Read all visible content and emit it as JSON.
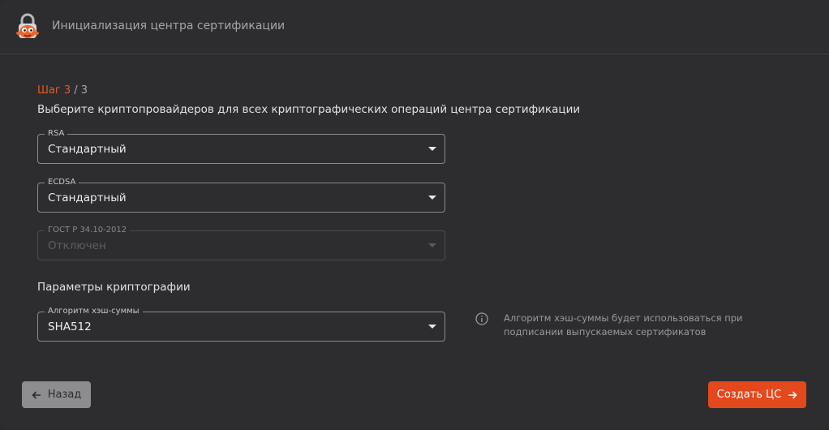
{
  "header": {
    "title": "Инициализация центра сертификации",
    "logo_icon": "padlock-mascot-icon"
  },
  "step": {
    "current": "Шаг 3",
    "separator_total": " / 3"
  },
  "instruction": "Выберите криптопровайдеров для всех криптографических операций центра сертификации",
  "providers": {
    "rsa": {
      "label": "RSA",
      "value": "Стандартный"
    },
    "ecdsa": {
      "label": "ECDSA",
      "value": "Стандартный"
    },
    "gost": {
      "label": "ГОСТ Р 34.10-2012",
      "value": "Отключен",
      "disabled": true
    }
  },
  "crypto_params": {
    "title": "Параметры криптографии",
    "hash": {
      "label": "Алгоритм хэш-суммы",
      "value": "SHA512"
    },
    "hint": "Алгоритм хэш-суммы будет использоваться при подписании выпускаемых сертификатов",
    "hint_icon": "info-icon"
  },
  "footer": {
    "back_label": "Назад",
    "back_icon": "arrow-left-icon",
    "create_label": "Создать ЦС",
    "create_icon": "arrow-right-icon"
  },
  "colors": {
    "accent": "#e4481d",
    "step_current": "#e05a2b",
    "background": "#2d2d2f"
  }
}
